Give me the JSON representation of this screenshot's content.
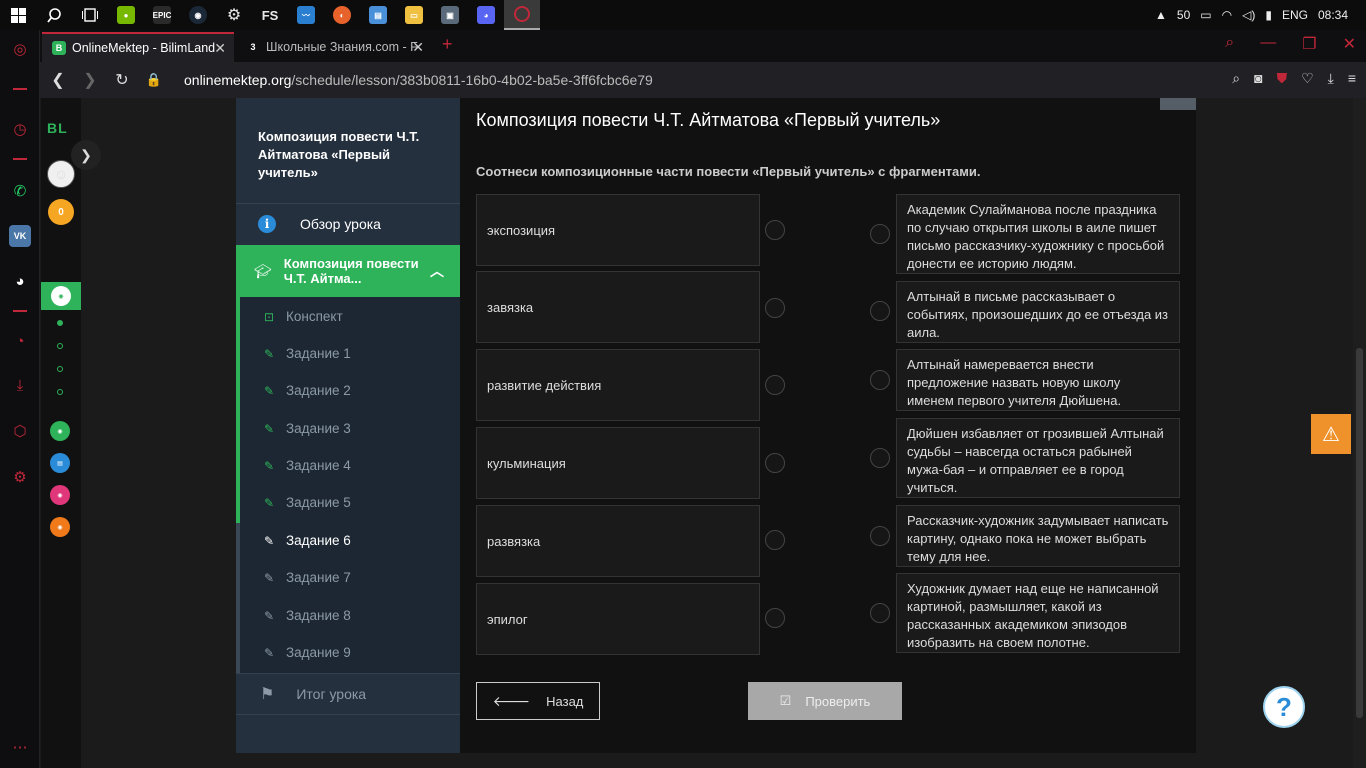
{
  "taskbar": {
    "icons": [
      "windows-icon",
      "search-icon",
      "task-view-icon",
      "nvidia-icon",
      "epic-icon",
      "steam-icon",
      "settings-icon",
      "fs-icon",
      "app-icon",
      "browser-icon",
      "app2-icon",
      "folder-icon",
      "app3-icon",
      "discord-icon",
      "opera-icon"
    ],
    "epic_label": "EPIC",
    "fs_label": "FS",
    "battery": "50",
    "language": "ENG",
    "time": "08:34"
  },
  "browser": {
    "tabs": [
      {
        "label": "OnlineMektep - BilimLand",
        "favicon": "B"
      },
      {
        "label": "Школьные Знания.com - F",
        "favicon": "3"
      }
    ],
    "url_host": "onlinemektep.org",
    "url_path": "/schedule/lesson/383b0811-16b0-4b02-ba5e-3ff6fcbc6e79"
  },
  "bl_strip": {
    "logo": "BL",
    "coins": "0"
  },
  "lesson_sidebar": {
    "title": "Композиция повести Ч.Т. Айтматова «Первый учитель»",
    "overview": "Обзор урока",
    "active_section": "Композиция повести Ч.Т. Айтма...",
    "items": [
      {
        "label": "Конспект"
      },
      {
        "label": "Задание 1"
      },
      {
        "label": "Задание 2"
      },
      {
        "label": "Задание 3"
      },
      {
        "label": "Задание 4"
      },
      {
        "label": "Задание 5"
      },
      {
        "label": "Задание 6"
      },
      {
        "label": "Задание 7"
      },
      {
        "label": "Задание 8"
      },
      {
        "label": "Задание 9"
      }
    ],
    "result": "Итог урока"
  },
  "main": {
    "title": "Композиция повести Ч.Т. Айтматова «Первый учитель»",
    "instruction": "Соотнеси композиционные части повести «Первый учитель» с фрагментами.",
    "left_items": [
      "экспозиция",
      "завязка",
      "развитие действия",
      "кульминация",
      "развязка",
      "эпилог"
    ],
    "right_items": [
      "Академик Сулайманова после праздника по случаю открытия школы в аиле пишет письмо рассказчику-художнику с просьбой донести ее историю людям.",
      "Алтынай в письме рассказывает о событиях, произошедших до ее отъезда из аила.",
      "Алтынай намеревается внести предложение назвать новую школу именем первого учителя Дюйшена.",
      "Дюйшен избавляет от грозившей Алтынай судьбы – навсегда остаться рабыней мужа-бая – и отправляет ее в город учиться.",
      "Рассказчик-художник задумывает написать картину, однако пока не может выбрать тему для нее.",
      "Художник думает над еще не написанной картиной, размышляет, какой из рассказанных академиком эпизодов изобразить на своем полотне."
    ],
    "back_label": "Назад",
    "check_label": "Проверить"
  },
  "colors": {
    "accent_green": "#2eb35a",
    "opera_red": "#c0283a",
    "sidebar_bg": "#24303e"
  }
}
